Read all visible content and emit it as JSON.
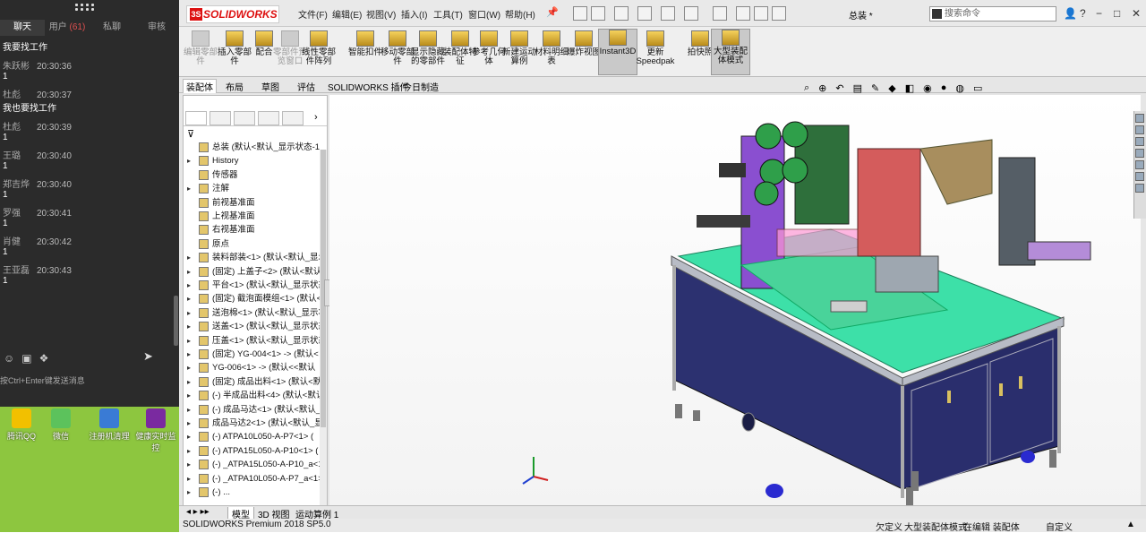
{
  "chat": {
    "tabs": [
      "聊天",
      "用户",
      "(61)",
      "私聊",
      "审核"
    ],
    "messages": [
      {
        "text": "我要找工作"
      },
      {
        "user": "朱跃彬",
        "time": "20:30:36",
        "text": "1"
      },
      {
        "user": "杜彪",
        "time": "20:30:37",
        "text": "我也要找工作"
      },
      {
        "user": "杜彪",
        "time": "20:30:39",
        "text": "1"
      },
      {
        "user": "王璐",
        "time": "20:30:40",
        "text": "1"
      },
      {
        "user": "郑吉烨",
        "time": "20:30:40",
        "text": "1"
      },
      {
        "user": "罗强",
        "time": "20:30:41",
        "text": "1"
      },
      {
        "user": "肖健",
        "time": "20:30:42",
        "text": "1"
      },
      {
        "user": "王亚磊",
        "time": "20:30:43",
        "text": "1"
      }
    ],
    "input_hint": "按Ctrl+Enter键发送消息",
    "icons": [
      "smile-icon",
      "image-icon",
      "gift-icon",
      "send-icon"
    ]
  },
  "desktop": {
    "icons": [
      {
        "label": "腾讯QQ",
        "color": "#f2c000"
      },
      {
        "label": "微信",
        "color": "#5cc25c"
      },
      {
        "label": "注册机清理",
        "color": "#3a7bd5"
      },
      {
        "label": "健康实时监控",
        "color": "#7a2aa0"
      }
    ]
  },
  "solidworks": {
    "logo": "SOLIDWORKS",
    "menus": [
      "文件(F)",
      "编辑(E)",
      "视图(V)",
      "插入(I)",
      "工具(T)",
      "窗口(W)",
      "帮助(H)"
    ],
    "doc_title": "总装 *",
    "search_placeholder": "搜索命令",
    "window_controls": [
      "?",
      "−",
      "□",
      "✕"
    ],
    "ribbon": [
      {
        "label": "编辑零部件",
        "dim": true
      },
      {
        "label": "插入零部件"
      },
      {
        "label": "配合"
      },
      {
        "label": "零部件预览窗口",
        "dim": true
      },
      {
        "label": "线性零部件阵列"
      },
      {
        "label": "智能扣件"
      },
      {
        "label": "移动零部件"
      },
      {
        "label": "显示隐藏的零部件"
      },
      {
        "label": "装配体特征"
      },
      {
        "label": "参考几何体"
      },
      {
        "label": "新建运动算例"
      },
      {
        "label": "材料明细表"
      },
      {
        "label": "爆炸视图"
      },
      {
        "label": "Instant3D",
        "hot": true
      },
      {
        "label": "更新Speedpak"
      },
      {
        "label": "拍快照"
      },
      {
        "label": "大型装配体模式",
        "hot": true
      }
    ],
    "cmd_tabs": [
      "装配体",
      "布局",
      "草图",
      "评估",
      "SOLIDWORKS 插件",
      "今日制造"
    ],
    "tree": [
      {
        "label": "总装 (默认<默认_显示状态-1>)",
        "arrow": "",
        "indent": 0
      },
      {
        "label": "History",
        "arrow": "▸"
      },
      {
        "label": "传感器",
        "arrow": ""
      },
      {
        "label": "注解",
        "arrow": "▸"
      },
      {
        "label": "前视基准面",
        "arrow": ""
      },
      {
        "label": "上视基准面",
        "arrow": ""
      },
      {
        "label": "右视基准面",
        "arrow": ""
      },
      {
        "label": "原点",
        "arrow": ""
      },
      {
        "label": "装料部装<1> (默认<默认_显示",
        "arrow": "▸"
      },
      {
        "label": "(固定) 上盖子<2> (默认<默认",
        "arrow": "▸"
      },
      {
        "label": "平台<1> (默认<默认_显示状态",
        "arrow": "▸"
      },
      {
        "label": "(固定) 截泡面模组<1> (默认<",
        "arrow": "▸"
      },
      {
        "label": "送泡棉<1> (默认<默认_显示状",
        "arrow": "▸"
      },
      {
        "label": "送盖<1> (默认<默认_显示状态",
        "arrow": "▸"
      },
      {
        "label": "压盖<1> (默认<默认_显示状态",
        "arrow": "▸"
      },
      {
        "label": "(固定) YG-004<1> -> (默认<",
        "arrow": "▸"
      },
      {
        "label": "YG-006<1> -> (默认<<默认",
        "arrow": "▸"
      },
      {
        "label": "(固定) 成品出料<1> (默认<默",
        "arrow": "▸"
      },
      {
        "label": "(-) 半成品出料<4> (默认<默认",
        "arrow": "▸"
      },
      {
        "label": "(-) 成品马达<1> (默认<默认_显",
        "arrow": "▸"
      },
      {
        "label": "成品马达2<1> (默认<默认_显",
        "arrow": "▸"
      },
      {
        "label": "(-) ATPA10L050-A-P7<1> (",
        "arrow": "▸"
      },
      {
        "label": "(-) ATPA15L050-A-P10<1> (",
        "arrow": "▸"
      },
      {
        "label": "(-) _ATPA15L050-A-P10_a<1",
        "arrow": "▸"
      },
      {
        "label": "(-) _ATPA10L050-A-P7_a<1>",
        "arrow": "▸"
      },
      {
        "label": "(-) ...",
        "arrow": "▸"
      }
    ],
    "bottom_tabs": [
      "模型",
      "3D 视图",
      "运动算例 1"
    ],
    "status": {
      "product": "SOLIDWORKS Premium 2018 SP5.0",
      "state": "欠定义",
      "mode": "大型装配体模式",
      "editing": "在编辑 装配体",
      "units": "自定义"
    },
    "colors": {
      "table_top": "#3de0a8",
      "cabinet": "#2b2f6e",
      "purple": "#8a4fd0"
    }
  }
}
